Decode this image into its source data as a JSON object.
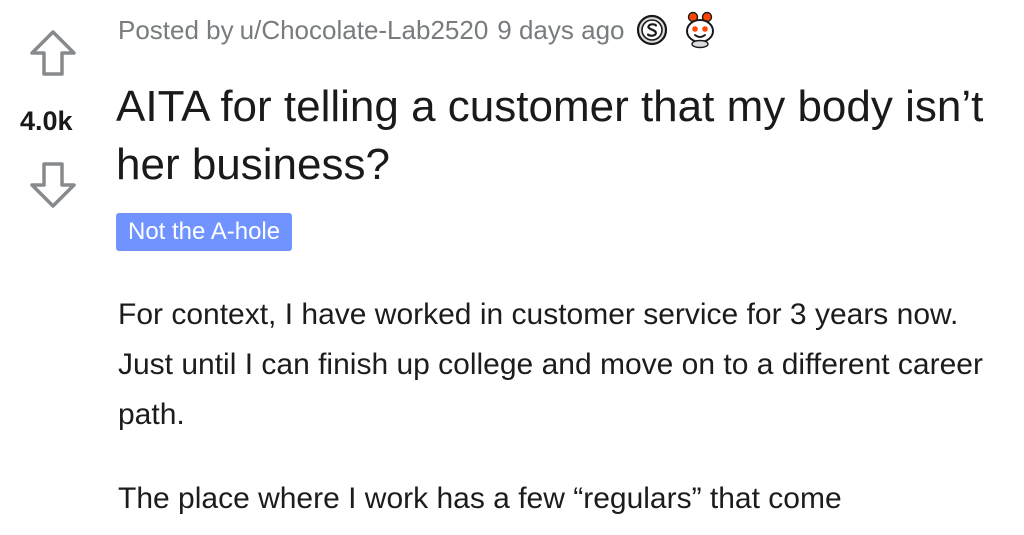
{
  "post": {
    "posted_by_prefix": "Posted by",
    "author": "u/Chocolate-Lab2520",
    "age": "9 days ago",
    "score": "4.0k",
    "title": "AITA for telling a customer that my body isn’t her business?",
    "flair": "Not the A-hole",
    "paragraphs": [
      "For context, I have worked in customer service for 3 years now. Just until I can finish up college and move on to a different career path.",
      "The place where I work has a few “regulars” that come"
    ]
  },
  "icons": {
    "upvote": "upvote-arrow-icon",
    "downvote": "downvote-arrow-icon",
    "award_1": "silver-coin-award-icon",
    "award_2": "wholesome-snoo-award-icon"
  },
  "colors": {
    "flair_bg": "#7193ff",
    "meta_text": "#787c7e",
    "title_text": "#1a1a1b",
    "award_red": "#ff4500"
  }
}
